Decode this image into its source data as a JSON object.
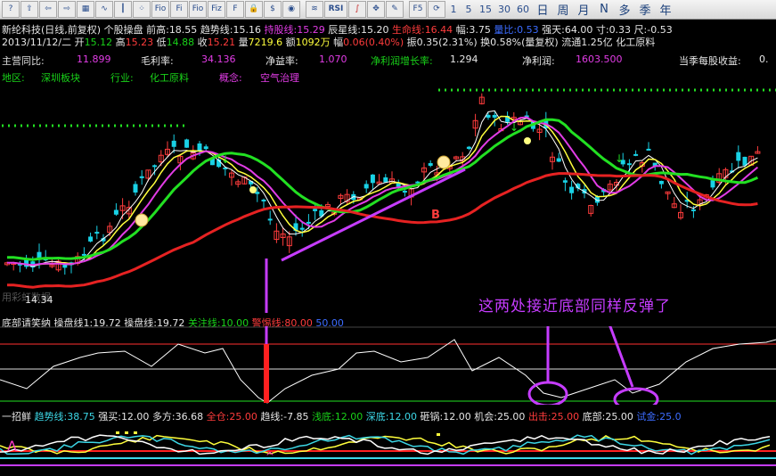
{
  "toolbar": {
    "buttons": [
      "question-icon",
      "up-icon",
      "left-icon",
      "right-icon",
      "grid-icon",
      "chart-icon",
      "candle-icon",
      "dots-icon",
      "Fio",
      "Fi",
      "Fio",
      "Fiz",
      "F",
      "lock-icon",
      "dollar-icon",
      "eye-icon",
      "F",
      "RSI",
      "cross-icon",
      "pen-icon"
    ],
    "f5": "F5",
    "periods_num": [
      "1",
      "5",
      "15",
      "30",
      "60"
    ],
    "periods_cn": [
      "日",
      "周",
      "月",
      "N",
      "多",
      "季",
      "年"
    ]
  },
  "info1": {
    "stock": "新纶科技(日线,前复权)",
    "indicator": "个股操盘",
    "qiangao_label": "前高:",
    "qiangao": "18.55",
    "qushi_label": "趋势线:",
    "qushi": "15.16",
    "chigu_label": "持股线:",
    "chigu": "15.29",
    "chenxing_label": "辰星线:",
    "chenxing": "15.20",
    "shengming_label": "生命线:",
    "shengming": "16.44",
    "fu_label": "幅:",
    "fu": "3.75",
    "liangbi_label": "量比:",
    "liangbi": "0.53",
    "qiangtian_label": "强天:",
    "qiangtian": "64.00",
    "cun_label": "寸:",
    "cun": "0.33",
    "chi_label": "尺:",
    "chi": "-0.53"
  },
  "info2": {
    "date": "2013/11/12/二",
    "open_label": "开",
    "open": "15.12",
    "high_label": "高",
    "high": "15.23",
    "low_label": "低",
    "low": "14.88",
    "close_label": "收",
    "close": "15.21",
    "vol_label": "量",
    "vol": "7219.6",
    "amt_label": "额",
    "amt": "1092万",
    "chg_label": "幅",
    "chg": "0.06(0.40%)",
    "amp_label": "振",
    "amp": "0.35(2.31%)",
    "turn_label": "换",
    "turn": "0.58%(量复权)",
    "float_label": "流通",
    "float": "1.25亿",
    "industry": "化工原料"
  },
  "fundamentals": {
    "yoy_label": "主营同比:",
    "yoy": "11.899",
    "gm_label": "毛利率:",
    "gm": "34.136",
    "nim_label": "净益率:",
    "nim": "1.070",
    "npg_label": "净利润增长率:",
    "npg": "1.294",
    "np_label": "净利润:",
    "np": "1603.500",
    "eps_label": "当季每股收益:",
    "eps": "0."
  },
  "tags": {
    "region_label": "地区:",
    "region": "深圳板块",
    "industry_label": "行业:",
    "industry": "化工原料",
    "concept_label": "概念:",
    "concept": "空气治理"
  },
  "main_chart": {
    "low_label": "14.34",
    "b_label": "B",
    "watermark": "用彩虹数据",
    "annotation": "这两处接近底部同样反弹了"
  },
  "panel2": {
    "name": "底部请笑纳",
    "l1_label": "操盘线1:",
    "l1": "19.72",
    "l2_label": "操盘线:",
    "l2": "19.72",
    "l3_label": "关注线:",
    "l3": "10.00",
    "l4_label": "警惕线:",
    "l4": "80.00",
    "l5": "50.00"
  },
  "panel3": {
    "name": "一招鲜",
    "a_label": "趋势线:",
    "a": "38.75",
    "b_label": "强买:",
    "b": "12.00",
    "c_label": "多方:",
    "c": "36.68",
    "d_label": "全仓:",
    "d": "25.00",
    "e_label": "趋线:",
    "e": "-7.85",
    "f_label": "浅底:",
    "f": "12.00",
    "g_label": "深底:",
    "g": "12.00",
    "h_label": "砸锅:",
    "h": "12.00",
    "i_label": "机会:",
    "i": "25.00",
    "j_label": "出击:",
    "j": "25.00",
    "k_label": "底部:",
    "k": "25.00",
    "l_label": "试金:",
    "l": "25.0"
  },
  "colors": {
    "up": "#ff3c3c",
    "down": "#19d2e6",
    "ma_green": "#22e022",
    "ma_red": "#e62222",
    "purple": "#c63cff"
  }
}
